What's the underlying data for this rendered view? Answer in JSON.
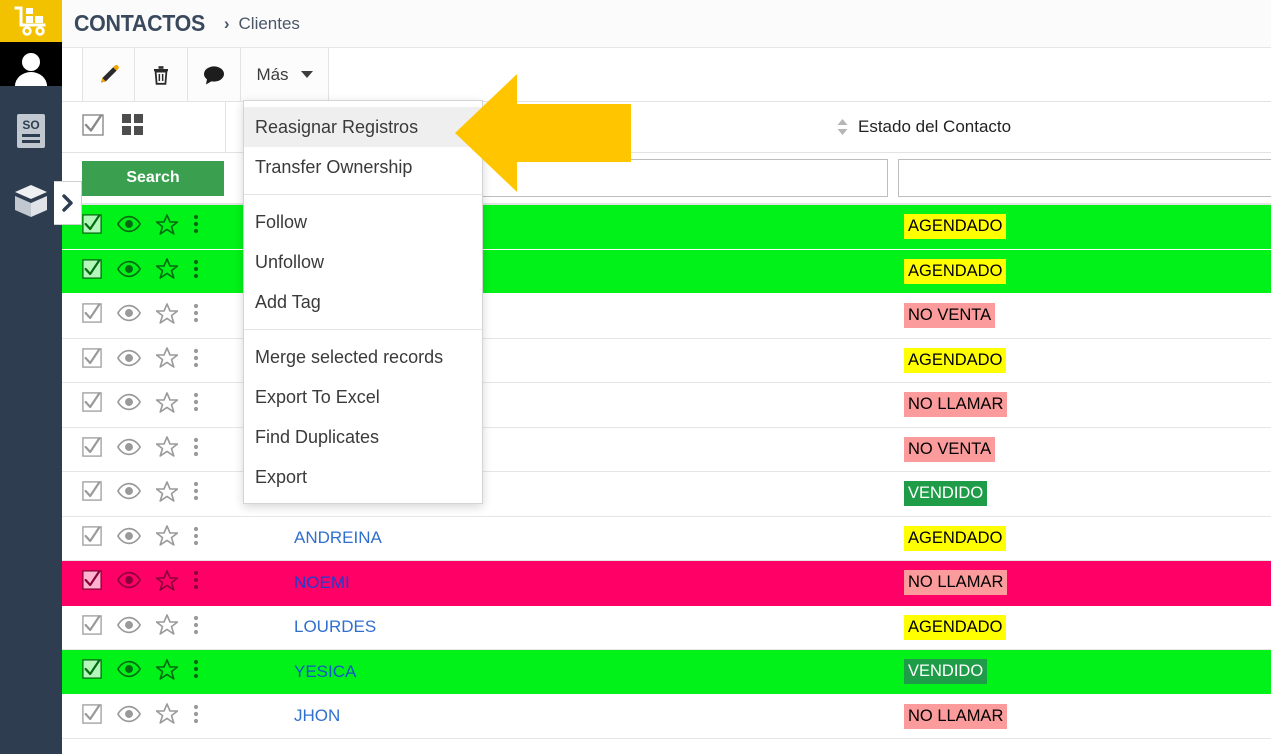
{
  "colors": {
    "brand_yellow": "#f2c200",
    "rail_bg": "#2e3d50",
    "row_green": "#00f218",
    "row_pink": "#ff0066",
    "badge_yellow": "#ffff00",
    "badge_red": "#fb9b9b",
    "badge_green": "#1f9c47",
    "search_green": "#3aa050",
    "link_blue": "#2f6fd0",
    "arrow_yellow": "#ffc600"
  },
  "rail": {
    "items": [
      {
        "name": "logo-cart-icon",
        "label": "Logo"
      },
      {
        "name": "user-avatar-icon",
        "label": "Usuario"
      },
      {
        "name": "sales-order-icon",
        "label": "SO"
      },
      {
        "name": "products-box-icon",
        "label": "Productos"
      }
    ],
    "expand_label": "›"
  },
  "breadcrumb": {
    "module": "CONTACTOS",
    "separator": "›",
    "current": "Clientes"
  },
  "toolbar": {
    "edit_title": "Editar",
    "delete_title": "Eliminar",
    "comment_title": "Comentario",
    "more_label": "Más"
  },
  "more_menu": {
    "groups": [
      {
        "items": [
          {
            "label": "Reasignar Registros",
            "active": true
          },
          {
            "label": "Transfer Ownership",
            "active": false
          }
        ]
      },
      {
        "items": [
          {
            "label": "Follow",
            "active": false
          },
          {
            "label": "Unfollow",
            "active": false
          },
          {
            "label": "Add Tag",
            "active": false
          }
        ]
      },
      {
        "items": [
          {
            "label": "Merge selected records",
            "active": false
          },
          {
            "label": "Export To Excel",
            "active": false
          },
          {
            "label": "Find Duplicates",
            "active": false
          },
          {
            "label": "Export",
            "active": false
          }
        ]
      }
    ]
  },
  "listview": {
    "select_all_checked": true,
    "grid_toggle_name": "grid-view-icon",
    "columns": [
      {
        "label": "Estado del Contacto",
        "sortable": true,
        "sort_state": "none"
      }
    ]
  },
  "search": {
    "button_label": "Search",
    "name_value": "",
    "name_placeholder": "",
    "estado_value": "",
    "estado_placeholder": ""
  },
  "rows": [
    {
      "name": "",
      "status": "AGENDADO",
      "status_kind": "agendado",
      "highlight": "green",
      "checked": true
    },
    {
      "name": "",
      "status": "AGENDADO",
      "status_kind": "agendado",
      "highlight": "green",
      "checked": true
    },
    {
      "name": "",
      "status": "NO VENTA",
      "status_kind": "noventa",
      "highlight": "white",
      "checked": true
    },
    {
      "name": "",
      "status": "AGENDADO",
      "status_kind": "agendado",
      "highlight": "white",
      "checked": true
    },
    {
      "name": "",
      "status": "NO LLAMAR",
      "status_kind": "nollamar",
      "highlight": "white",
      "checked": true
    },
    {
      "name": "",
      "status": "NO VENTA",
      "status_kind": "noventa",
      "highlight": "white",
      "checked": true
    },
    {
      "name": "",
      "status": "VENDIDO",
      "status_kind": "vendido",
      "highlight": "white",
      "checked": true
    },
    {
      "name": "ANDREINA",
      "status": "AGENDADO",
      "status_kind": "agendado",
      "highlight": "white",
      "checked": true
    },
    {
      "name": "NOEMI",
      "status": "NO LLAMAR",
      "status_kind": "nollamar",
      "highlight": "pink",
      "checked": true
    },
    {
      "name": "LOURDES",
      "status": "AGENDADO",
      "status_kind": "agendado",
      "highlight": "white",
      "checked": true
    },
    {
      "name": "YESICA",
      "status": "VENDIDO",
      "status_kind": "vendido",
      "highlight": "green",
      "checked": true
    },
    {
      "name": "JHON",
      "status": "NO LLAMAR",
      "status_kind": "nollamar",
      "highlight": "white",
      "checked": true
    }
  ],
  "annotation": {
    "arrow_direction": "left",
    "points_to": "Reasignar Registros"
  }
}
